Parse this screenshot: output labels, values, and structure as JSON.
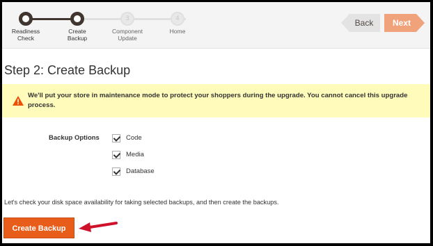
{
  "steps": [
    {
      "label_line1": "Readiness",
      "label_line2": "Check",
      "state": "done"
    },
    {
      "label_line1": "Create",
      "label_line2": "Backup",
      "state": "current"
    },
    {
      "label_line1": "Component",
      "label_line2": "Update",
      "number": "3",
      "state": "todo"
    },
    {
      "label_line1": "Home",
      "label_line2": "",
      "number": "4",
      "state": "todo"
    }
  ],
  "nav": {
    "back_label": "Back",
    "next_label": "Next"
  },
  "page_title": "Step 2: Create Backup",
  "warning": {
    "icon": "warning-triangle-icon",
    "text": "We'll put your store in maintenance mode to protect your shoppers during the upgrade. You cannot cancel this upgrade process."
  },
  "backup": {
    "label": "Backup Options",
    "options": [
      {
        "label": "Code",
        "checked": true
      },
      {
        "label": "Media",
        "checked": true
      },
      {
        "label": "Database",
        "checked": true
      }
    ]
  },
  "info_text": "Let's check your disk space availability for taking selected backups, and then create the backups.",
  "create_button_label": "Create Backup",
  "colors": {
    "accent": "#e85d1a",
    "next": "#f0a37b",
    "warning_bg": "#fffbbb",
    "arrow": "#d0112b"
  }
}
